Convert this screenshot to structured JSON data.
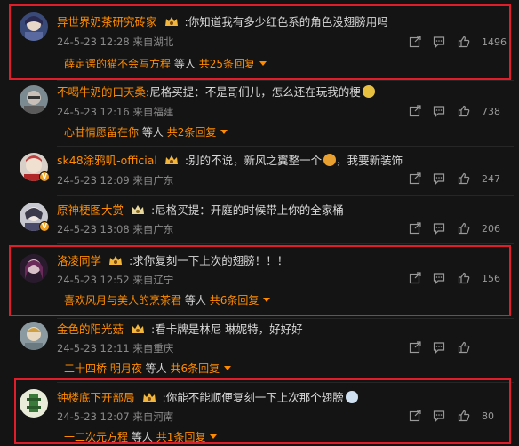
{
  "comments": [
    {
      "username": "异世界奶茶研究砖家",
      "text": ":你知道我有多少红色系的角色没翅膀用吗",
      "date": "24-5-23 12:28",
      "location": "来自湖北",
      "likes": "1496",
      "reply_names": "薛定谔的猫不会写方程",
      "reply_mid": "等人",
      "reply_count": "共25条回复",
      "highlighted": true
    },
    {
      "username": "不喝牛奶的口天桑",
      "text": ":尼格买提：不是哥们儿，怎么还在玩我的梗",
      "date": "24-5-23 12:16",
      "location": "来自福建",
      "likes": "738",
      "reply_names": "心甘情愿留在你",
      "reply_mid": "等人",
      "reply_count": "共2条回复",
      "highlighted": false
    },
    {
      "username": "sk48涂鸦叽-official",
      "text": ":别的不说，新风之翼整一个",
      "text_tail": "，我要新装饰",
      "date": "24-5-23 12:09",
      "location": "来自广东",
      "likes": "247",
      "highlighted": false
    },
    {
      "username": "原神梗图大赏",
      "text": ":尼格买提：开庭的时候带上你的全家桶",
      "date": "24-5-23 13:08",
      "location": "来自广东",
      "likes": "206",
      "highlighted": false
    },
    {
      "username": "洛凌同学",
      "text": ":求你复刻一下上次的翅膀！！！",
      "date": "24-5-23 12:52",
      "location": "来自辽宁",
      "likes": "156",
      "reply_names": "喜欢风月与美人的烹茶君",
      "reply_mid": "等人",
      "reply_count": "共6条回复",
      "highlighted": true
    },
    {
      "username": "金色的阳光菇",
      "text": ":看卡牌是林尼 琳妮特，好好好",
      "date": "24-5-23 12:11",
      "location": "来自重庆",
      "likes": "",
      "reply_names": "二十四桥 明月夜",
      "reply_mid": "等人",
      "reply_count": "共6条回复",
      "highlighted": false
    },
    {
      "username": "钟楼底下开部局",
      "text": ":你能不能顺便复刻一下上次那个翅膀",
      "date": "24-5-23 12:07",
      "location": "来自河南",
      "likes": "80",
      "reply_names": "一二次元方程",
      "reply_mid": "等人",
      "reply_count": "共1条回复",
      "highlighted": true
    }
  ],
  "colors": {
    "background": "#141414",
    "username": "#ff8c00",
    "highlight_border": "#e11d2a",
    "meta_text": "#8a8a8a"
  },
  "icons": [
    "share-icon",
    "comment-icon",
    "like-icon",
    "level-crown-icon",
    "verified-badge-icon",
    "emoji-icon"
  ]
}
